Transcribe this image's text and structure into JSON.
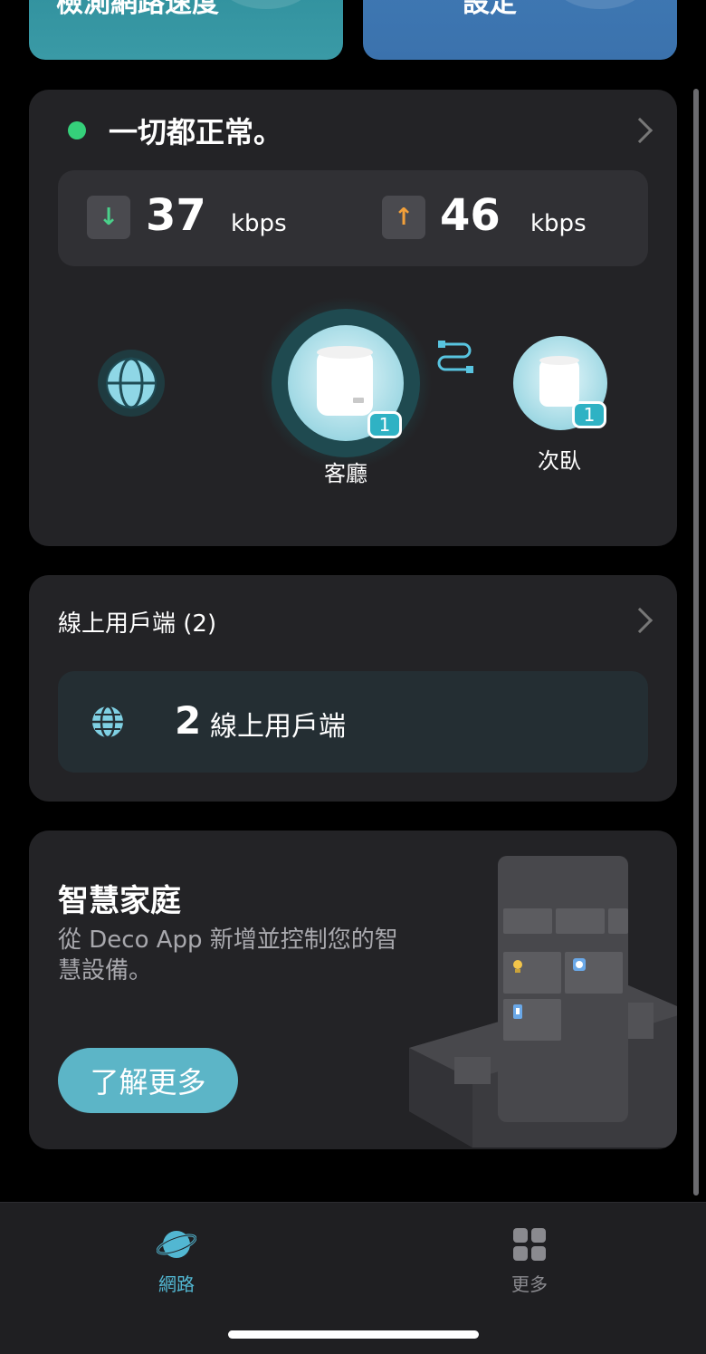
{
  "top_cards": {
    "left_text": "檢測網路速度",
    "right_text": "設定"
  },
  "status": {
    "title": "一切都正常。",
    "download_value": "37",
    "download_unit": "kbps",
    "upload_value": "46",
    "upload_unit": "kbps",
    "arrow_down": "↓",
    "arrow_up": "↑",
    "main_node_label": "客廳",
    "main_node_badge": "1",
    "sub_node_label": "次臥",
    "sub_node_badge": "1"
  },
  "clients": {
    "title": "線上用戶端 (2)",
    "count": "2",
    "label": "線上用戶端"
  },
  "smart_home": {
    "title": "智慧家庭",
    "description": "從 Deco App 新增並控制您的智慧設備。",
    "button_label": "了解更多"
  },
  "tabbar": {
    "network_label": "網路",
    "more_label": "更多"
  },
  "colors": {
    "accent": "#52b7d2",
    "status_ok": "#35d07a",
    "card": "#232326"
  }
}
